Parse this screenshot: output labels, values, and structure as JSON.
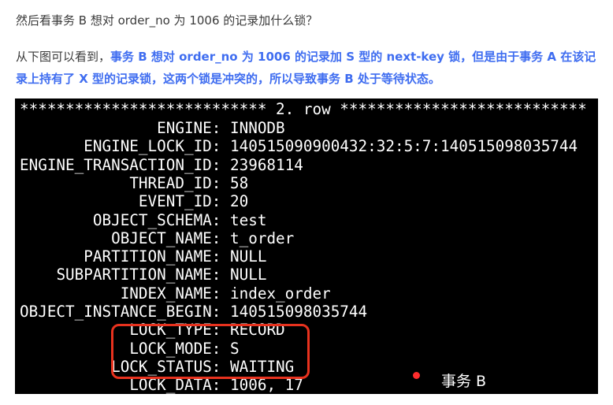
{
  "question": "然后看事务 B 想对 order_no 为 1006 的记录加什么锁？",
  "paragraph": {
    "prefix": "从下图可以看到，",
    "emphasis": "事务 B 想对 order_no 为 1006 的记录加 S 型的 next-key 锁，但是由于事务 A 在该记录上持有了 X 型的记录锁，这两个锁是冲突的，所以导致事务 B 处于等待状态。"
  },
  "terminal": {
    "header": "*************************** 2. row ***************************",
    "rows": [
      {
        "key": "ENGINE",
        "value": "INNODB"
      },
      {
        "key": "ENGINE_LOCK_ID",
        "value": "140515090900432:32:5:7:140515098035744"
      },
      {
        "key": "ENGINE_TRANSACTION_ID",
        "value": "23968114"
      },
      {
        "key": "THREAD_ID",
        "value": "58"
      },
      {
        "key": "EVENT_ID",
        "value": "20"
      },
      {
        "key": "OBJECT_SCHEMA",
        "value": "test"
      },
      {
        "key": "OBJECT_NAME",
        "value": "t_order"
      },
      {
        "key": "PARTITION_NAME",
        "value": "NULL"
      },
      {
        "key": "SUBPARTITION_NAME",
        "value": "NULL"
      },
      {
        "key": "INDEX_NAME",
        "value": "index_order"
      },
      {
        "key": "OBJECT_INSTANCE_BEGIN",
        "value": "140515098035744"
      },
      {
        "key": "LOCK_TYPE",
        "value": "RECORD"
      },
      {
        "key": "LOCK_MODE",
        "value": "S"
      },
      {
        "key": "LOCK_STATUS",
        "value": "WAITING"
      },
      {
        "key": "LOCK_DATA",
        "value": "1006, 17"
      }
    ]
  },
  "annotation": {
    "label": "事务 B",
    "dot_color": "#ff2d2d",
    "box_color": "#e8321e"
  },
  "colors": {
    "emphasis": "#3f6df0",
    "terminal_bg": "#000000",
    "terminal_fg": "#ffffff"
  }
}
